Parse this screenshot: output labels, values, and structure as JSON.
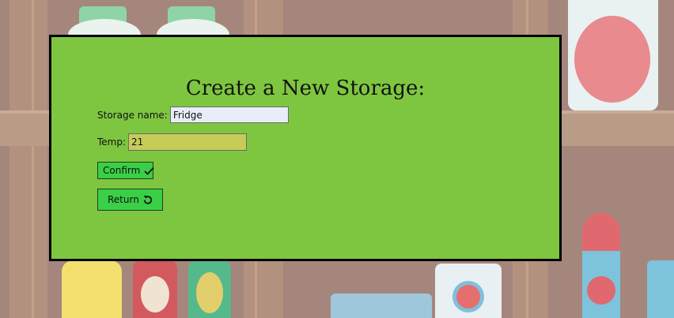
{
  "dialog": {
    "title": "Create a New Storage:",
    "name_label": "Storage name:",
    "name_value": "Fridge",
    "temp_label": "Temp:",
    "temp_value": "21",
    "confirm_label": "Confirm",
    "confirm_icon": "checkmark-icon",
    "return_label": "Return",
    "return_icon": "undo-icon"
  },
  "colors": {
    "modal_background": "#7ec640",
    "button_background": "#3bcf47",
    "name_input_background": "#e8eef8",
    "temp_input_background": "#c7cc58",
    "page_background": "#a5867d"
  }
}
